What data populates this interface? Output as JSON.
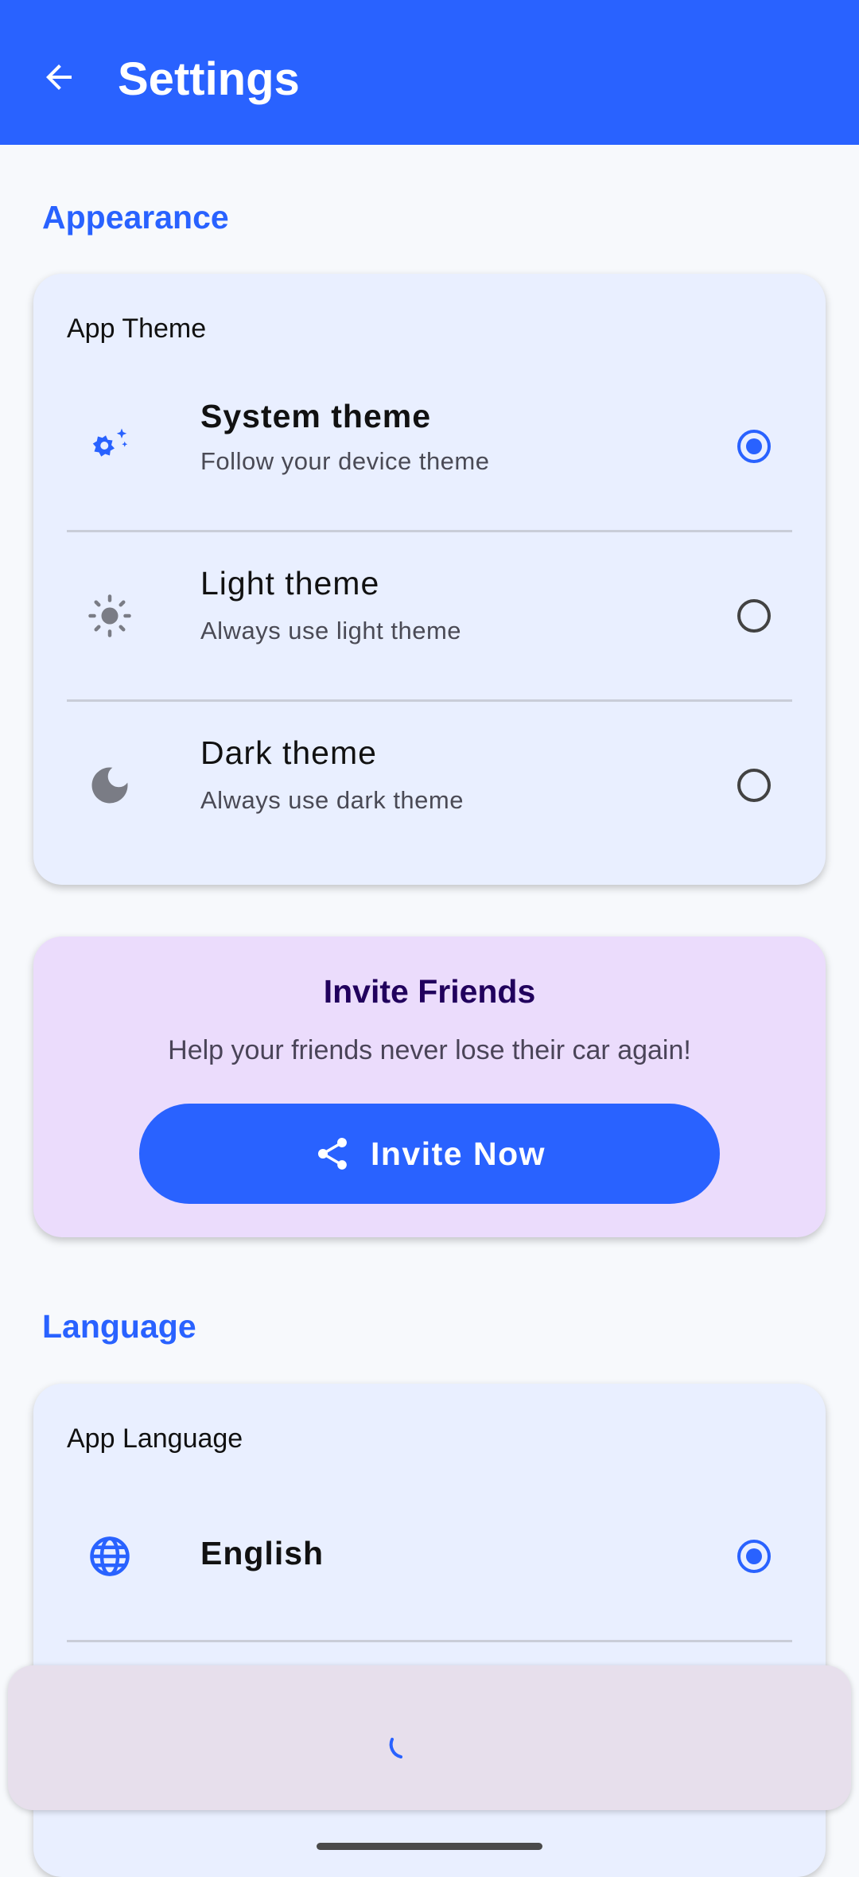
{
  "appbar": {
    "title": "Settings",
    "back_icon": "arrow-back-icon"
  },
  "appearance": {
    "section_title": "Appearance",
    "card_label": "App Theme",
    "options": [
      {
        "title": "System theme",
        "subtitle": "Follow your device theme",
        "icon": "auto-theme-icon",
        "selected": true
      },
      {
        "title": "Light theme",
        "subtitle": "Always use light theme",
        "icon": "sun-icon",
        "selected": false
      },
      {
        "title": "Dark theme",
        "subtitle": "Always use dark theme",
        "icon": "moon-icon",
        "selected": false
      }
    ]
  },
  "invite": {
    "title": "Invite Friends",
    "subtitle": "Help your friends never lose their car again!",
    "button_label": "Invite Now",
    "button_icon": "share-icon"
  },
  "language": {
    "section_title": "Language",
    "card_label": "App Language",
    "options": [
      {
        "title": "English",
        "icon": "globe-icon",
        "selected": true
      }
    ]
  },
  "colors": {
    "primary": "#2962ff",
    "background": "#f7f9fc",
    "card": "#e9efff",
    "invite_card": "#ebdcfc",
    "invite_title": "#21005d",
    "bottom_sheet": "#e7dfec"
  }
}
